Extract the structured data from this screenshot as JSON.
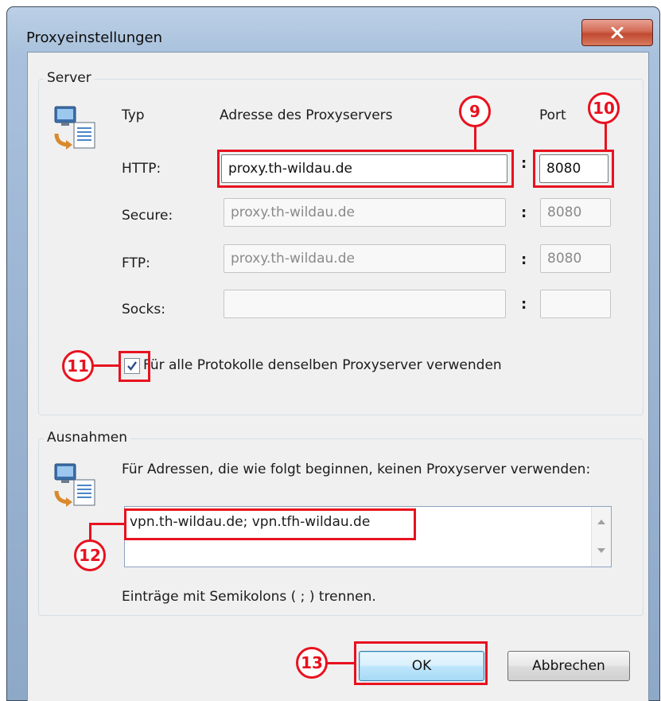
{
  "window": {
    "title": "Proxyeinstellungen",
    "close_label": "x"
  },
  "server": {
    "legend": "Server",
    "col_type": "Typ",
    "col_address": "Adresse des Proxyservers",
    "col_port": "Port",
    "rows": [
      {
        "label": "HTTP:",
        "address": "proxy.th-wildau.de",
        "port": "8080"
      },
      {
        "label": "Secure:",
        "address": "proxy.th-wildau.de",
        "port": "8080"
      },
      {
        "label": "FTP:",
        "address": "proxy.th-wildau.de",
        "port": "8080"
      },
      {
        "label": "Socks:",
        "address": "",
        "port": ""
      }
    ],
    "separator": ":",
    "same_proxy_label": "Für alle Protokolle denselben Proxyserver verwenden",
    "same_proxy_checked": true
  },
  "exceptions": {
    "legend": "Ausnahmen",
    "description": "Für Adressen, die wie folgt beginnen, keinen Proxyserver verwenden:",
    "value": "vpn.th-wildau.de; vpn.tfh-wildau.de",
    "hint": "Einträge mit Semikolons ( ; ) trennen."
  },
  "buttons": {
    "ok": "OK",
    "cancel": "Abbrechen"
  },
  "annotations": {
    "address": "9",
    "port": "10",
    "checkbox": "11",
    "exceptions": "12",
    "ok": "13"
  },
  "colors": {
    "annotation": "#e8121f",
    "title_bar": "#a9c1dc",
    "close": "#c24a32"
  }
}
